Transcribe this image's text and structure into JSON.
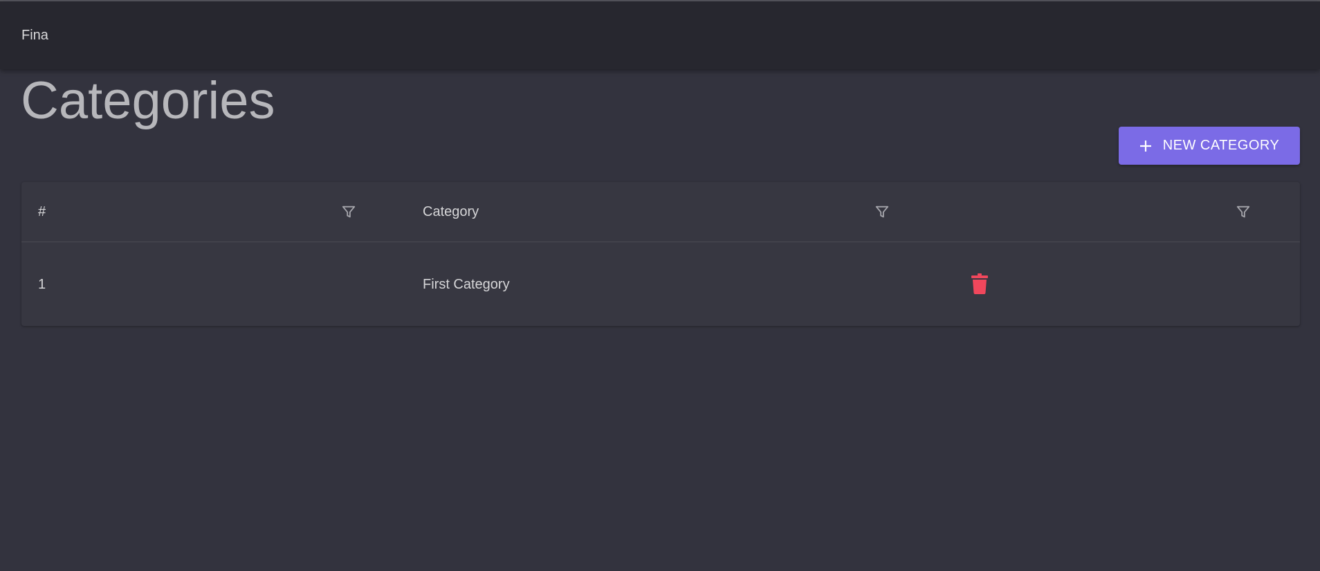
{
  "app": {
    "title": "Fina"
  },
  "page": {
    "title": "Categories"
  },
  "actions": {
    "new_category_label": "NEW CATEGORY",
    "new_category_icon": "plus-icon"
  },
  "table": {
    "columns": [
      {
        "label": "#",
        "filter_icon": "filter-icon"
      },
      {
        "label": "Category",
        "filter_icon": "filter-icon"
      },
      {
        "label": "",
        "filter_icon": "filter-icon"
      }
    ],
    "rows": [
      {
        "id": "1",
        "category": "First Category",
        "action_icon": "trash-icon"
      }
    ]
  },
  "colors": {
    "background": "#33333e",
    "appbar": "#27272f",
    "primary": "#7b6be6",
    "danger": "#f0475c",
    "table_surface": "#373741"
  }
}
